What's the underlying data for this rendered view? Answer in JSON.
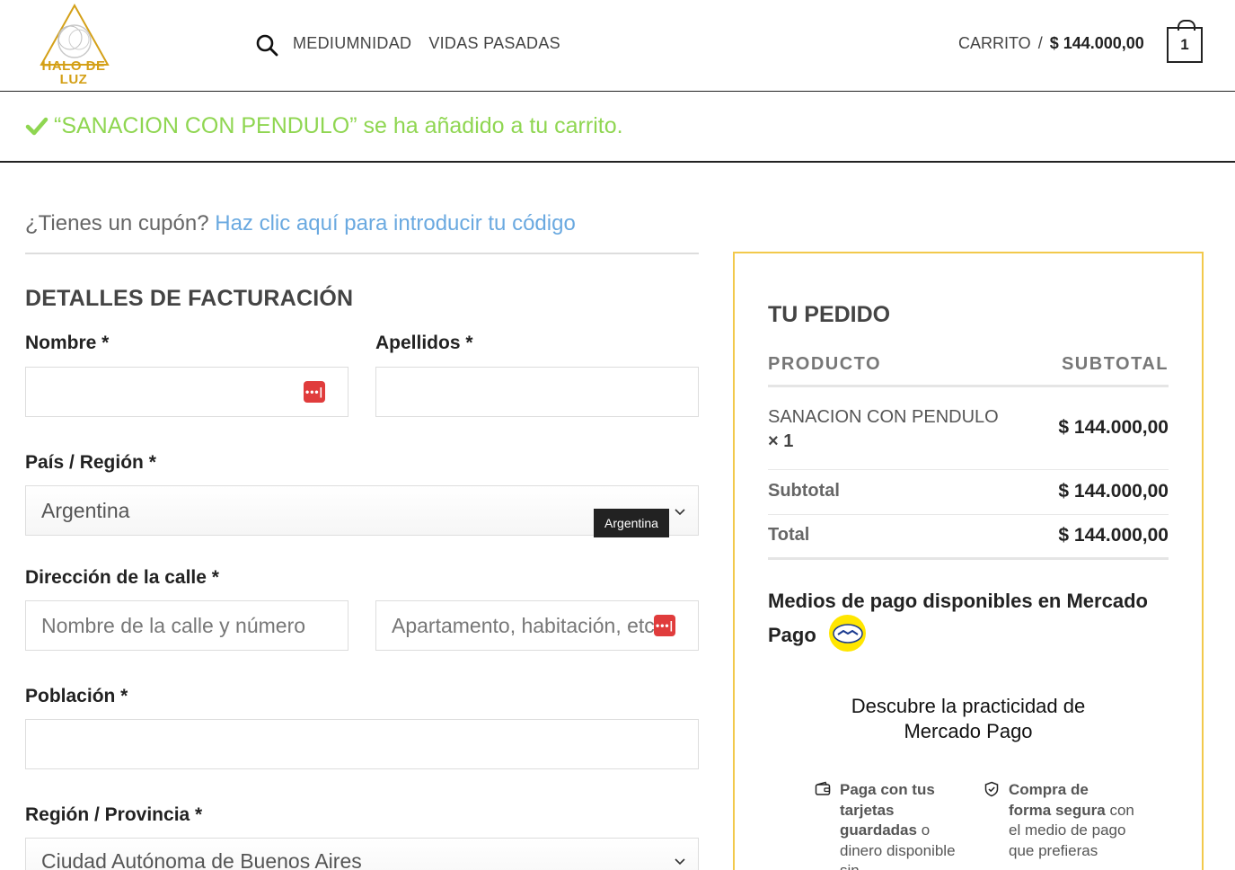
{
  "header": {
    "logo_text": "HALO DE LUZ",
    "nav": [
      "MEDIUMNIDAD",
      "VIDAS PASADAS"
    ],
    "cart_label": "CARRITO",
    "cart_separator": "/",
    "cart_amount": "$ 144.000,00",
    "cart_count": "1"
  },
  "notice": {
    "message": "“SANACION CON PENDULO” se ha añadido a tu carrito."
  },
  "coupon": {
    "question": "¿Tienes un cupón?",
    "link": "Haz clic aquí para introducir tu código"
  },
  "billing": {
    "title": "DETALLES DE FACTURACIÓN",
    "first_name_label": "Nombre *",
    "last_name_label": "Apellidos *",
    "country_label": "País / Región *",
    "country_value": "Argentina",
    "country_tooltip": "Argentina",
    "street_label": "Dirección de la calle *",
    "street_placeholder": "Nombre de la calle y número",
    "street2_placeholder": "Apartamento, habitación, etc.",
    "city_label": "Población *",
    "state_label": "Región / Provincia *",
    "state_value": "Ciudad Autónoma de Buenos Aires"
  },
  "order": {
    "title": "TU PEDIDO",
    "col_product": "PRODUCTO",
    "col_subtotal": "SUBTOTAL",
    "product_name": "SANACION CON PENDULO",
    "product_qty": "× 1",
    "product_amount": "$ 144.000,00",
    "subtotal_label": "Subtotal",
    "subtotal_amount": "$ 144.000,00",
    "total_label": "Total",
    "total_amount": "$ 144.000,00",
    "payment_title": "Medios de pago disponibles en Mercado Pago",
    "discover": "Descubre la practicidad de Mercado Pago",
    "feature1_bold1": "Paga con tus tarjetas guardadas",
    "feature1_rest": "o dinero disponible sin",
    "feature2_bold": "Compra de forma segura",
    "feature2_rest": "con el medio de pago que prefieras"
  },
  "colors": {
    "success": "#8fd651",
    "link": "#6aa9e0",
    "order_border": "#f2c94c",
    "logo_gold": "#d4a017",
    "password_icon": "#e03c3c",
    "mp_yellow": "#ffe600"
  },
  "icons": [
    "logo-triangle-icon",
    "search-icon",
    "cart-bag-icon",
    "checkmark-icon",
    "password-manager-icon",
    "chevron-down-icon",
    "mercado-pago-handshake-icon",
    "wallet-icon",
    "shield-check-icon"
  ]
}
